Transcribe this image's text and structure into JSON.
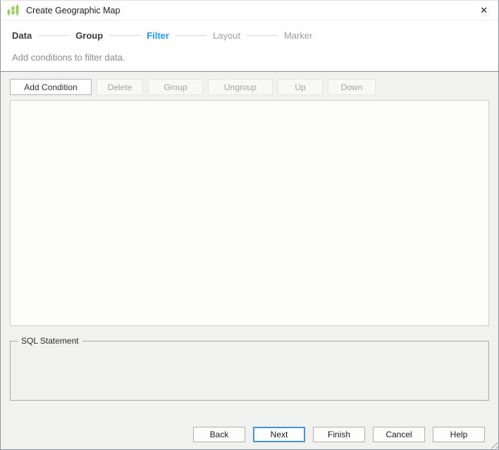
{
  "window": {
    "title": "Create Geographic Map"
  },
  "icons": {
    "app": "green-bar-chart",
    "close": "✕"
  },
  "wizard": {
    "steps": [
      {
        "label": "Data",
        "state": "completed"
      },
      {
        "label": "Group",
        "state": "completed"
      },
      {
        "label": "Filter",
        "state": "active"
      },
      {
        "label": "Layout",
        "state": "upcoming"
      },
      {
        "label": "Marker",
        "state": "upcoming"
      }
    ],
    "description": "Add conditions to filter data."
  },
  "toolbar": {
    "buttons": [
      {
        "label": "Add Condition",
        "enabled": true
      },
      {
        "label": "Delete",
        "enabled": false
      },
      {
        "label": "Group",
        "enabled": false
      },
      {
        "label": "Ungroup",
        "enabled": false
      },
      {
        "label": "Up",
        "enabled": false
      },
      {
        "label": "Down",
        "enabled": false
      }
    ]
  },
  "conditions_list": {
    "items": []
  },
  "sql": {
    "label": "SQL Statement",
    "content": ""
  },
  "footer": {
    "buttons": [
      {
        "label": "Back",
        "default": false
      },
      {
        "label": "Next",
        "default": true
      },
      {
        "label": "Finish",
        "default": false
      },
      {
        "label": "Cancel",
        "default": false
      },
      {
        "label": "Help",
        "default": false
      }
    ]
  },
  "colors": {
    "accent_blue": "#1e97f3",
    "step_text": "#3b3b3b",
    "muted_text": "#9d9d9d",
    "icon_green": "#9bcf62",
    "body_background": "#f1f2f0"
  }
}
